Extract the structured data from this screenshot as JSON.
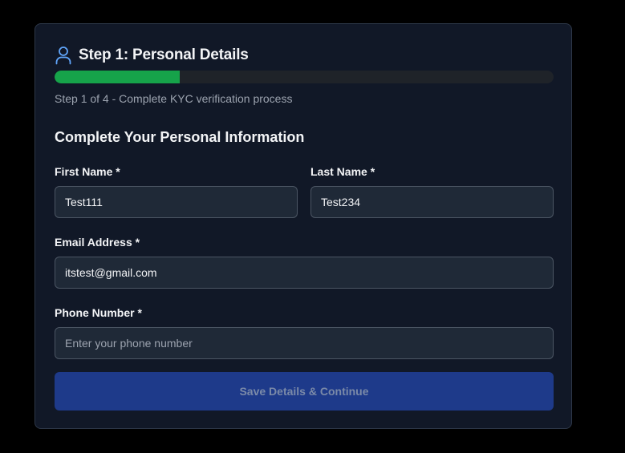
{
  "step": {
    "title": "Step 1: Personal Details",
    "icon": "user-icon",
    "progress_fraction": 0.25,
    "progress_color": "#16a34a",
    "progress_text": "Step 1 of 4 - Complete KYC verification process"
  },
  "form": {
    "heading": "Complete Your Personal Information",
    "first_name": {
      "label": "First Name *",
      "value": "Test111"
    },
    "last_name": {
      "label": "Last Name *",
      "value": "Test234"
    },
    "email": {
      "label": "Email Address *",
      "value": "itstest@gmail.com"
    },
    "phone": {
      "label": "Phone Number *",
      "value": "",
      "placeholder": "Enter your phone number"
    },
    "submit_label": "Save Details & Continue",
    "submit_color": "#1e3a8a"
  }
}
